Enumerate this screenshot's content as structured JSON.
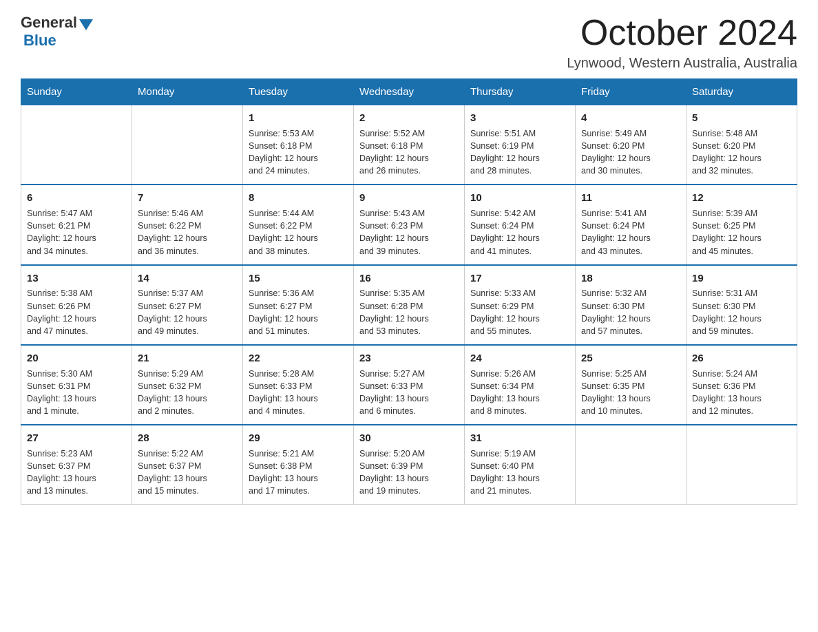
{
  "logo": {
    "text_general": "General",
    "triangle": "▶",
    "text_blue": "Blue"
  },
  "title": {
    "month": "October 2024",
    "location": "Lynwood, Western Australia, Australia"
  },
  "headers": [
    "Sunday",
    "Monday",
    "Tuesday",
    "Wednesday",
    "Thursday",
    "Friday",
    "Saturday"
  ],
  "weeks": [
    [
      {
        "day": "",
        "info": ""
      },
      {
        "day": "",
        "info": ""
      },
      {
        "day": "1",
        "info": "Sunrise: 5:53 AM\nSunset: 6:18 PM\nDaylight: 12 hours\nand 24 minutes."
      },
      {
        "day": "2",
        "info": "Sunrise: 5:52 AM\nSunset: 6:18 PM\nDaylight: 12 hours\nand 26 minutes."
      },
      {
        "day": "3",
        "info": "Sunrise: 5:51 AM\nSunset: 6:19 PM\nDaylight: 12 hours\nand 28 minutes."
      },
      {
        "day": "4",
        "info": "Sunrise: 5:49 AM\nSunset: 6:20 PM\nDaylight: 12 hours\nand 30 minutes."
      },
      {
        "day": "5",
        "info": "Sunrise: 5:48 AM\nSunset: 6:20 PM\nDaylight: 12 hours\nand 32 minutes."
      }
    ],
    [
      {
        "day": "6",
        "info": "Sunrise: 5:47 AM\nSunset: 6:21 PM\nDaylight: 12 hours\nand 34 minutes."
      },
      {
        "day": "7",
        "info": "Sunrise: 5:46 AM\nSunset: 6:22 PM\nDaylight: 12 hours\nand 36 minutes."
      },
      {
        "day": "8",
        "info": "Sunrise: 5:44 AM\nSunset: 6:22 PM\nDaylight: 12 hours\nand 38 minutes."
      },
      {
        "day": "9",
        "info": "Sunrise: 5:43 AM\nSunset: 6:23 PM\nDaylight: 12 hours\nand 39 minutes."
      },
      {
        "day": "10",
        "info": "Sunrise: 5:42 AM\nSunset: 6:24 PM\nDaylight: 12 hours\nand 41 minutes."
      },
      {
        "day": "11",
        "info": "Sunrise: 5:41 AM\nSunset: 6:24 PM\nDaylight: 12 hours\nand 43 minutes."
      },
      {
        "day": "12",
        "info": "Sunrise: 5:39 AM\nSunset: 6:25 PM\nDaylight: 12 hours\nand 45 minutes."
      }
    ],
    [
      {
        "day": "13",
        "info": "Sunrise: 5:38 AM\nSunset: 6:26 PM\nDaylight: 12 hours\nand 47 minutes."
      },
      {
        "day": "14",
        "info": "Sunrise: 5:37 AM\nSunset: 6:27 PM\nDaylight: 12 hours\nand 49 minutes."
      },
      {
        "day": "15",
        "info": "Sunrise: 5:36 AM\nSunset: 6:27 PM\nDaylight: 12 hours\nand 51 minutes."
      },
      {
        "day": "16",
        "info": "Sunrise: 5:35 AM\nSunset: 6:28 PM\nDaylight: 12 hours\nand 53 minutes."
      },
      {
        "day": "17",
        "info": "Sunrise: 5:33 AM\nSunset: 6:29 PM\nDaylight: 12 hours\nand 55 minutes."
      },
      {
        "day": "18",
        "info": "Sunrise: 5:32 AM\nSunset: 6:30 PM\nDaylight: 12 hours\nand 57 minutes."
      },
      {
        "day": "19",
        "info": "Sunrise: 5:31 AM\nSunset: 6:30 PM\nDaylight: 12 hours\nand 59 minutes."
      }
    ],
    [
      {
        "day": "20",
        "info": "Sunrise: 5:30 AM\nSunset: 6:31 PM\nDaylight: 13 hours\nand 1 minute."
      },
      {
        "day": "21",
        "info": "Sunrise: 5:29 AM\nSunset: 6:32 PM\nDaylight: 13 hours\nand 2 minutes."
      },
      {
        "day": "22",
        "info": "Sunrise: 5:28 AM\nSunset: 6:33 PM\nDaylight: 13 hours\nand 4 minutes."
      },
      {
        "day": "23",
        "info": "Sunrise: 5:27 AM\nSunset: 6:33 PM\nDaylight: 13 hours\nand 6 minutes."
      },
      {
        "day": "24",
        "info": "Sunrise: 5:26 AM\nSunset: 6:34 PM\nDaylight: 13 hours\nand 8 minutes."
      },
      {
        "day": "25",
        "info": "Sunrise: 5:25 AM\nSunset: 6:35 PM\nDaylight: 13 hours\nand 10 minutes."
      },
      {
        "day": "26",
        "info": "Sunrise: 5:24 AM\nSunset: 6:36 PM\nDaylight: 13 hours\nand 12 minutes."
      }
    ],
    [
      {
        "day": "27",
        "info": "Sunrise: 5:23 AM\nSunset: 6:37 PM\nDaylight: 13 hours\nand 13 minutes."
      },
      {
        "day": "28",
        "info": "Sunrise: 5:22 AM\nSunset: 6:37 PM\nDaylight: 13 hours\nand 15 minutes."
      },
      {
        "day": "29",
        "info": "Sunrise: 5:21 AM\nSunset: 6:38 PM\nDaylight: 13 hours\nand 17 minutes."
      },
      {
        "day": "30",
        "info": "Sunrise: 5:20 AM\nSunset: 6:39 PM\nDaylight: 13 hours\nand 19 minutes."
      },
      {
        "day": "31",
        "info": "Sunrise: 5:19 AM\nSunset: 6:40 PM\nDaylight: 13 hours\nand 21 minutes."
      },
      {
        "day": "",
        "info": ""
      },
      {
        "day": "",
        "info": ""
      }
    ]
  ]
}
